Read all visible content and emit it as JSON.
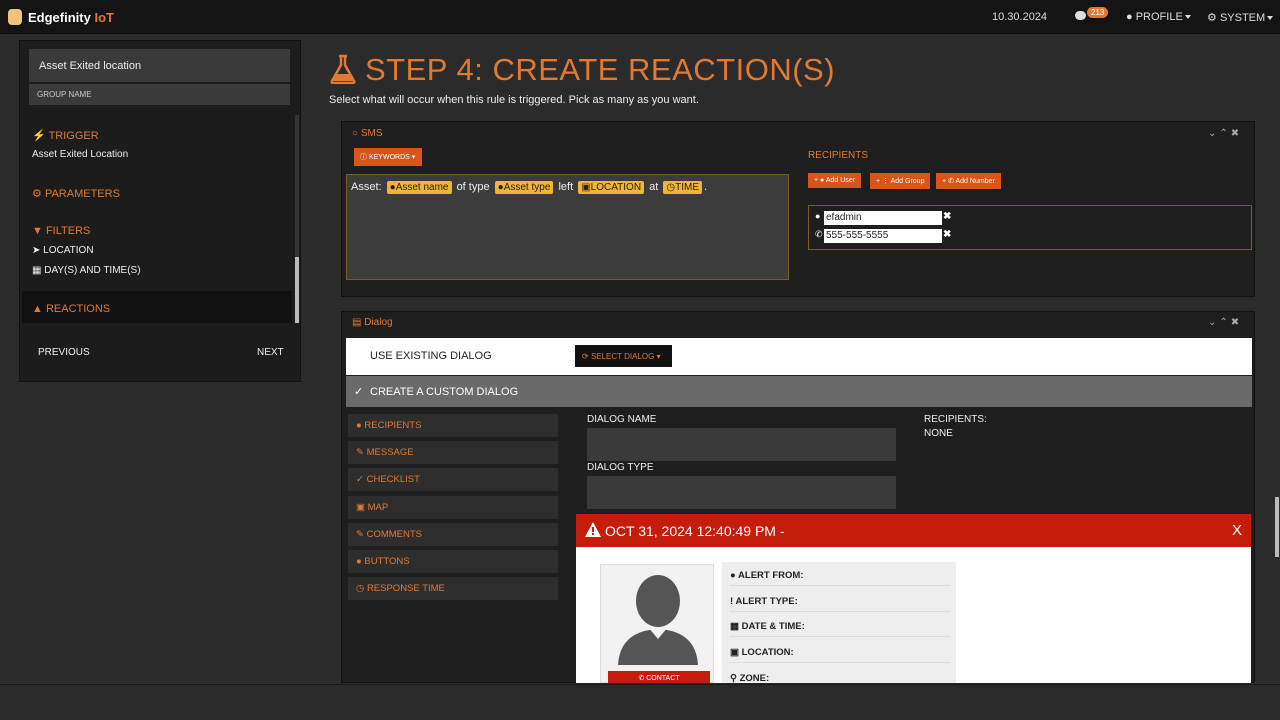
{
  "topbar": {
    "brand_main": "Edgefinity",
    "brand_suffix": "IoT",
    "date": "10.30.2024",
    "messages_count": "213",
    "profile_label": "PROFILE",
    "system_label": "SYSTEM"
  },
  "sidebar": {
    "rule_name": "Asset Exited location",
    "group_name_label": "GROUP NAME",
    "steps": [
      {
        "label": "TRIGGER",
        "icon": "bolt-icon",
        "subitems": [
          "Asset Exited Location"
        ]
      },
      {
        "label": "PARAMETERS",
        "icon": "cogs-icon",
        "subitems": []
      },
      {
        "label": "FILTERS",
        "icon": "filter-icon",
        "subitems": [
          "LOCATION",
          "DAY(S) AND TIME(S)"
        ]
      },
      {
        "label": "REACTIONS",
        "icon": "flask-icon",
        "subitems": [],
        "active": true
      }
    ],
    "previous_label": "PREVIOUS",
    "next_label": "NEXT"
  },
  "step": {
    "title": "STEP 4: CREATE REACTION(S)",
    "subtitle": "Select what will occur when this rule is triggered. Pick as many as you want."
  },
  "sms": {
    "title": "SMS",
    "keywords_label": "KEYWORDS",
    "message": {
      "prefix": "Asset:",
      "tag_asset_name": "Asset name",
      "text_of_type": "of type",
      "tag_asset_type": "Asset type",
      "text_left": "left",
      "tag_location": "LOCATION",
      "text_at": "at",
      "tag_time": "TIME",
      "suffix": "."
    },
    "recipients_label": "RECIPIENTS",
    "add_user_label": "Add User",
    "add_group_label": "Add Group",
    "add_number_label": "Add Number",
    "recipients": [
      {
        "type": "user",
        "value": "efadmin"
      },
      {
        "type": "phone",
        "value": "555-555-5555"
      }
    ]
  },
  "dialog": {
    "title": "Dialog",
    "use_existing_label": "USE EXISTING DIALOG",
    "select_dialog_label": "SELECT DIALOG",
    "create_custom_label": "CREATE A CUSTOM DIALOG",
    "tabs": [
      "RECIPIENTS",
      "MESSAGE",
      "CHECKLIST",
      "MAP",
      "COMMENTS",
      "BUTTONS",
      "RESPONSE TIME"
    ],
    "dialog_name_label": "DIALOG NAME",
    "dialog_type_label": "DIALOG TYPE",
    "recipients_label": "RECIPIENTS:",
    "recipients_value": "NONE"
  },
  "alert": {
    "title": "OCT 31, 2024 12:40:49 PM -",
    "close_label": "X",
    "contact_label": "CONTACT",
    "fields": [
      "ALERT FROM:",
      "ALERT TYPE:",
      "DATE & TIME:",
      "LOCATION:",
      "ZONE:"
    ]
  },
  "colors": {
    "accent": "#e07a33",
    "alert_red": "#c61c0c",
    "tag_yellow": "#f0b537"
  }
}
